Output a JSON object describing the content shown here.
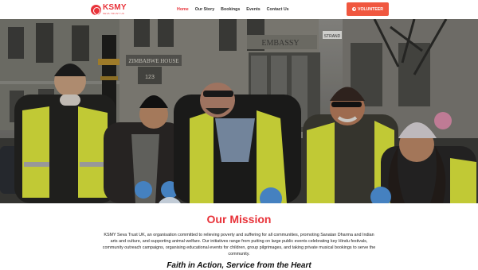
{
  "header": {
    "logo_title": "KSMY",
    "logo_subtitle": "SEVA TRUST UK",
    "nav": [
      {
        "label": "Home",
        "active": true
      },
      {
        "label": "Our Story",
        "active": false
      },
      {
        "label": "Bookings",
        "active": false
      },
      {
        "label": "Events",
        "active": false
      },
      {
        "label": "Contact Us",
        "active": false
      }
    ],
    "volunteer_label": "VOLUNTEER"
  },
  "hero": {
    "signs": [
      "ZIMBABWE HOUSE",
      "EMBASSY",
      "STRAND",
      "123"
    ]
  },
  "mission": {
    "title": "Our Mission",
    "description": "KSMY Seva Trust UK, an organisation committed to relieving poverty and suffering for all communities, promoting Sanatan Dharma and Indian arts and culture, and supporting animal welfare. Our initiatives range from putting on large public events celebrating key Hindu festivals, community outreach campaigns, organising educational events for children, group pilgrimages, and taking private musical bookings to serve the community.",
    "subheading": "Faith in Action, Service from the Heart"
  },
  "colors": {
    "brand": "#e8333a",
    "button": "#f0573f",
    "vest": "#d9e43a"
  }
}
